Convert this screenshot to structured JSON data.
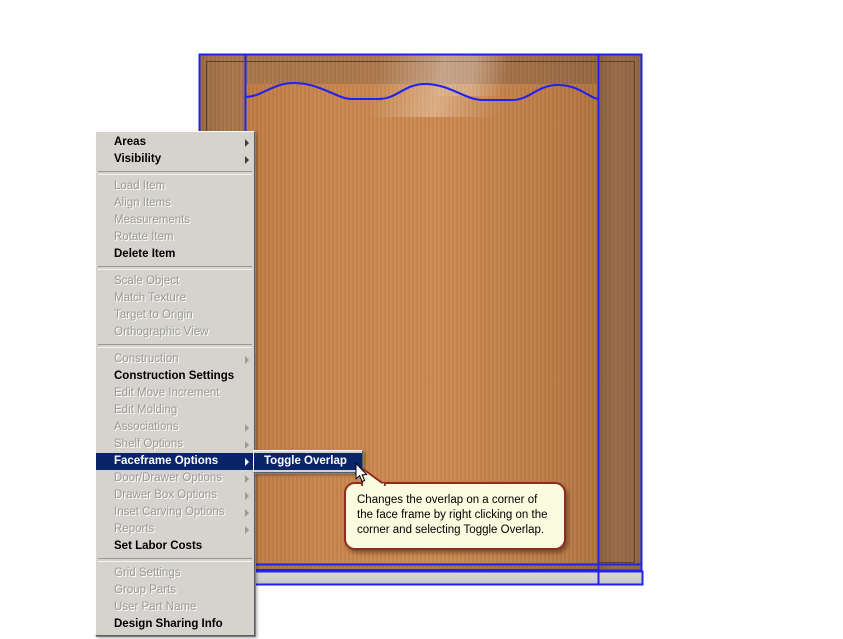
{
  "app": {
    "viewport_name": "cabinet-3d-view"
  },
  "context_menu": {
    "name": "right-click-context-menu",
    "groups": [
      {
        "items": [
          {
            "label": "Areas",
            "state": "enabled",
            "submenu": true,
            "selected": false
          },
          {
            "label": "Visibility",
            "state": "enabled",
            "submenu": true,
            "selected": false
          }
        ]
      },
      {
        "items": [
          {
            "label": "Load Item",
            "state": "disabled",
            "submenu": false,
            "selected": false
          },
          {
            "label": "Align Items",
            "state": "disabled",
            "submenu": false,
            "selected": false
          },
          {
            "label": "Measurements",
            "state": "disabled",
            "submenu": false,
            "selected": false
          },
          {
            "label": "Rotate Item",
            "state": "disabled",
            "submenu": false,
            "selected": false
          },
          {
            "label": "Delete Item",
            "state": "enabled",
            "submenu": false,
            "selected": false
          }
        ]
      },
      {
        "items": [
          {
            "label": "Scale Object",
            "state": "disabled",
            "submenu": false,
            "selected": false
          },
          {
            "label": "Match Texture",
            "state": "disabled",
            "submenu": false,
            "selected": false
          },
          {
            "label": "Target to Origin",
            "state": "disabled",
            "submenu": false,
            "selected": false
          },
          {
            "label": "Orthographic View",
            "state": "disabled",
            "submenu": false,
            "selected": false
          }
        ]
      },
      {
        "items": [
          {
            "label": "Construction",
            "state": "disabled",
            "submenu": true,
            "selected": false
          },
          {
            "label": "Construction Settings",
            "state": "enabled",
            "submenu": false,
            "selected": false
          },
          {
            "label": "Edit Move Increment",
            "state": "disabled",
            "submenu": false,
            "selected": false
          },
          {
            "label": "Edit Molding",
            "state": "disabled",
            "submenu": false,
            "selected": false
          },
          {
            "label": "Associations",
            "state": "disabled",
            "submenu": true,
            "selected": false
          },
          {
            "label": "Shelf Options",
            "state": "disabled",
            "submenu": true,
            "selected": false
          },
          {
            "label": "Faceframe Options",
            "state": "enabled",
            "submenu": true,
            "selected": true
          },
          {
            "label": "Door/Drawer Options",
            "state": "disabled",
            "submenu": true,
            "selected": false
          },
          {
            "label": "Drawer Box Options",
            "state": "disabled",
            "submenu": true,
            "selected": false
          },
          {
            "label": "Inset Carving Options",
            "state": "disabled",
            "submenu": true,
            "selected": false
          },
          {
            "label": "Reports",
            "state": "disabled",
            "submenu": true,
            "selected": false
          },
          {
            "label": "Set Labor Costs",
            "state": "enabled",
            "submenu": false,
            "selected": false
          }
        ]
      },
      {
        "items": [
          {
            "label": "Grid Settings",
            "state": "disabled",
            "submenu": false,
            "selected": false
          },
          {
            "label": "Group Parts",
            "state": "disabled",
            "submenu": false,
            "selected": false
          },
          {
            "label": "User Part Name",
            "state": "disabled",
            "submenu": false,
            "selected": false
          },
          {
            "label": "Design Sharing Info",
            "state": "enabled",
            "submenu": false,
            "selected": false
          }
        ]
      }
    ]
  },
  "submenu": {
    "name": "faceframe-options-submenu",
    "items": [
      {
        "label": "Toggle Overlap",
        "state": "enabled",
        "submenu": false,
        "selected": true
      }
    ]
  },
  "tooltip": {
    "name": "toggle-overlap-tooltip",
    "text": "Changes the overlap on a corner of the face frame by right clicking on the corner and selecting Toggle Overlap."
  },
  "colors": {
    "menu_face": "#d6d3ce",
    "menu_highlight": "#0a246a",
    "menu_disabled_text": "#9a9a96",
    "tooltip_fill": "#fbfbdf",
    "tooltip_border": "#8f2b20",
    "guide_line": "#2222ee",
    "wood_door": "#cd8a4f",
    "wood_frame": "#a9764b"
  }
}
